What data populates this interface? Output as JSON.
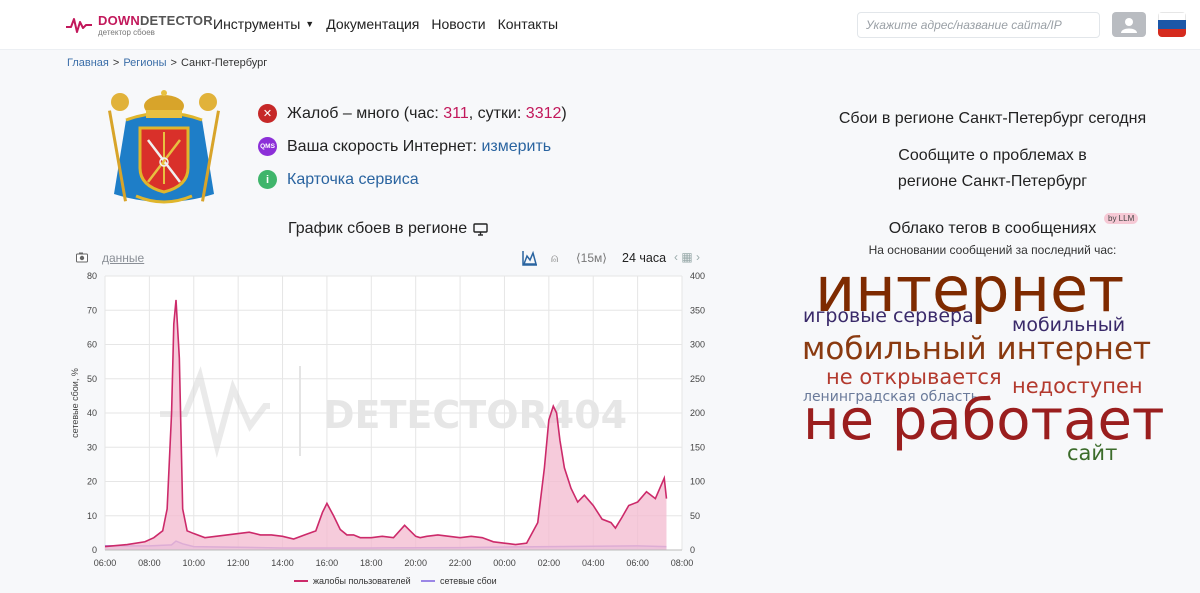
{
  "header": {
    "logo_title_a": "DOWN",
    "logo_title_b": "DETECTOR",
    "logo_sub": "детектор сбоев",
    "nav": [
      "Инструменты",
      "Документация",
      "Новости",
      "Контакты"
    ],
    "search_placeholder": "Укажите адрес/название сайта/IP"
  },
  "breadcrumb": {
    "home": "Главная",
    "sep": ">",
    "regions": "Регионы",
    "current": "Санкт-Петербург"
  },
  "status": {
    "complaints_prefix": "Жалоб – много (час: ",
    "hour_value": "311",
    "complaints_mid": ", сутки: ",
    "day_value": "3312",
    "complaints_suffix": ")",
    "speed_prefix": "Ваша скорость Интернет: ",
    "speed_link": "измерить",
    "speed_icon_text": "QMS",
    "service_card": "Карточка сервиса"
  },
  "chart_section": {
    "title": "График сбоев в регионе",
    "data_link": "данные",
    "range_15": "⟨15м⟩",
    "range_24": "24 часа"
  },
  "right": {
    "outages_today": "Сбои в регионе Санкт-Петербург сегодня",
    "report_line1": "Сообщите о проблемах в",
    "report_line2": "регионе Санкт-Петербург",
    "cloud_title": "Облако тегов в сообщениях",
    "llm_badge": "by LLM",
    "cloud_sub": "На основании сообщений за последний час:",
    "tags": [
      "интернет",
      "игровые сервера",
      "мобильный",
      "мобильный интернет",
      "не открывается",
      "недоступен",
      "ленинградская область",
      "не работает",
      "сайт"
    ]
  },
  "colors": {
    "accent": "#c2185b",
    "link": "#2a64a0",
    "complaints_line": "#cc2a6a",
    "complaints_fill": "#f3b9cf",
    "outage_line": "#9b87e6",
    "outage_fill": "#d8cff7"
  },
  "chart_data": {
    "type": "area",
    "watermark": "DETECTOR404",
    "ylabel_left": "сетевые сбои, %",
    "ylabel_right": "жалобы пользователей",
    "ylim_left": [
      0,
      80
    ],
    "ylim_right": [
      0,
      400
    ],
    "yticks_left": [
      0,
      10,
      20,
      30,
      40,
      50,
      60,
      70,
      80
    ],
    "yticks_right": [
      0,
      50,
      100,
      150,
      200,
      250,
      300,
      350,
      400
    ],
    "xticks": [
      "06:00",
      "08:00",
      "10:00",
      "12:00",
      "14:00",
      "16:00",
      "18:00",
      "20:00",
      "22:00",
      "00:00",
      "02:00",
      "04:00",
      "06:00",
      "08:00"
    ],
    "xlim": [
      0,
      26
    ],
    "grid": true,
    "legend": "bottom",
    "series": [
      {
        "name": "жалобы пользователей",
        "axis": "right",
        "x": [
          0,
          1,
          1.8,
          2.2,
          2.6,
          2.8,
          3.0,
          3.1,
          3.2,
          3.35,
          3.5,
          3.7,
          4.0,
          4.5,
          5,
          5.5,
          6,
          6.5,
          7,
          7.5,
          8,
          8.5,
          9,
          9.5,
          9.8,
          10,
          10.3,
          10.6,
          10.9,
          11.2,
          11.5,
          12,
          12.5,
          13,
          13.5,
          14,
          14.2,
          14.5,
          15,
          15.5,
          16,
          16.5,
          17,
          17.5,
          18,
          18.5,
          19,
          19.5,
          19.8,
          20,
          20.2,
          20.35,
          20.5,
          20.7,
          21,
          21.3,
          21.6,
          22,
          22.4,
          22.8,
          23,
          23.3,
          23.6,
          24,
          24.4,
          24.8,
          25.0,
          25.2,
          25.3
        ],
        "values": [
          5,
          8,
          12,
          18,
          28,
          60,
          200,
          330,
          365,
          280,
          60,
          28,
          24,
          18,
          20,
          22,
          24,
          26,
          22,
          22,
          20,
          16,
          22,
          28,
          55,
          68,
          50,
          30,
          22,
          22,
          18,
          18,
          20,
          18,
          36,
          20,
          18,
          20,
          22,
          20,
          18,
          20,
          18,
          12,
          10,
          8,
          10,
          40,
          120,
          190,
          210,
          200,
          160,
          120,
          90,
          70,
          80,
          65,
          45,
          40,
          32,
          48,
          65,
          70,
          85,
          75,
          90,
          105,
          75
        ]
      },
      {
        "name": "сетевые сбои",
        "axis": "left",
        "x": [
          0,
          2,
          3.0,
          3.2,
          3.5,
          4,
          8,
          12,
          16,
          20,
          24,
          25.3
        ],
        "values": [
          1.2,
          1.2,
          1.5,
          2.6,
          1.8,
          1.0,
          0.6,
          0.6,
          0.7,
          1.0,
          1.2,
          1.0
        ]
      }
    ]
  }
}
